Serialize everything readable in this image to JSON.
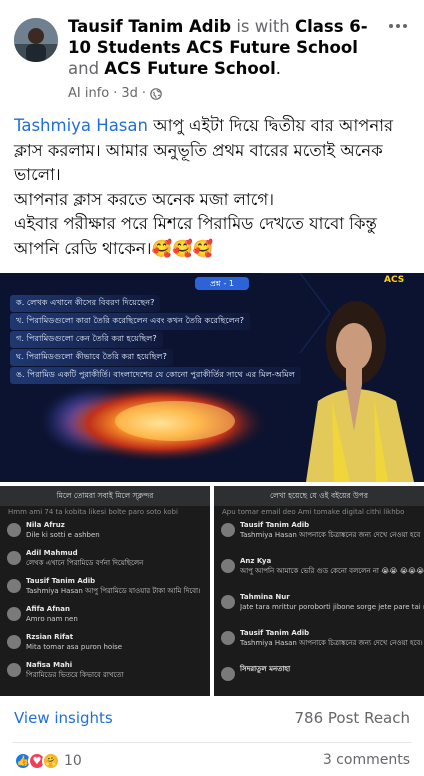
{
  "header": {
    "author": "Tausif Tanim Adib",
    "is_with": "is with",
    "group1": "Class 6-10 Students  ACS Future School",
    "and": "and",
    "group2": "ACS Future School",
    "period": ".",
    "meta_prefix": "AI info",
    "meta_sep": "·",
    "time": "3d",
    "meta_sep2": "·"
  },
  "post": {
    "mention": "Tashmiya Hasan",
    "line1_rest": " আপু এইটা দিয়ে দ্বিতীয় বার আপনার ক্লাস করলাম। আমার অনুভূতি প্রথম বারের মতোই অনেক ভালো।",
    "line2": "আপনার ক্লাস করতে অনেক মজা লাগে।",
    "line3": "এইবার পরীক্ষার পরে মিশরে পিরামিড দেখতে যাবো কিন্তু আপনি রেডি থাকেন।🥰🥰🥰"
  },
  "main_image": {
    "badge": "প্রশ্ন - 1",
    "logo": "ACS",
    "questions": [
      "ক. লেখক এখানে কীসের বিবরণ দিয়েছেন?",
      "খ. পিরামিডগুলো কারা তৈরি করেছিলেন এবং কখন তৈরি করেছিলেন?",
      "গ. পিরামিডগুলো কেন তৈরি করা হয়েছিল?",
      "ঘ. পিরামিডগুলো কীভাবে তৈরি করা হয়েছিল?",
      "ঙ. পিরামিড একটি পুরাকীর্তি। বাংলাদেশের যে কোনো পুরাকীর্তির সাথে এর মিল-অমিল"
    ]
  },
  "left_panel": {
    "banner": "মিলে তোমরা সবাই মিলে স্ক্লন্দর",
    "first": "Hmm ami 74 ta kobita likesi bolte paro soto kobi",
    "rows": [
      {
        "name": "Nila Afruz",
        "msg": "Dile ki sotti e ashben"
      },
      {
        "name": "Adil Mahmud",
        "msg": "লেখক এখানে পিরামিডে বর্ণনা দিয়েছিলেন"
      },
      {
        "name": "Tausif Tanim Adib",
        "msg": "Tashmiya Hasan আপু পিরামিডে যাওয়ার টাকা আমি দিবো।"
      },
      {
        "name": "Afifa Afnan",
        "msg": "Amro nam nen"
      },
      {
        "name": "Rzsian Rifat",
        "msg": "Mita tomar asa puron hoise"
      },
      {
        "name": "Nafisa Mahi",
        "msg": "পিরামিডের ভিতরে কিভাবে রাখতো"
      }
    ]
  },
  "right_panel": {
    "banner": "লেখা হয়েছে যে ওই বইয়ের উপর",
    "first": "Apu tomar email deo Ami tomake digital cithi likhbo",
    "rows": [
      {
        "name": "Tausif Tanim Adib",
        "msg": "Tashmiya Hasan আপনাকে চিত্রাঙ্কনের জন্য দেখে নেওয়া হবে"
      },
      {
        "name": "Anz Kya",
        "msg": "আপু আপনি আমাকে ভেরি গুড কেনো বললেন না 😭😭 😭😭😭😭😭"
      },
      {
        "name": "Tahmina Nur",
        "msg": "Jate tara mrittur poroborti jibone sorge jete pare tai momi banano hoto"
      },
      {
        "name": "Tausif Tanim Adib",
        "msg": "Tashmiya Hasan আপনাকে চিত্রাঙ্কনের জন্য দেখে নেওয়া হবে।"
      },
      {
        "name": "সিদরাতুল মনতাহা",
        "msg": ""
      }
    ]
  },
  "footer": {
    "insights": "View insights",
    "reach": "786 Post Reach",
    "reaction_count": "10",
    "comments": "3 comments"
  },
  "colors": {
    "link": "#216fdb",
    "muted": "#65676b",
    "like": "#1877f2",
    "love": "#f33e58"
  }
}
